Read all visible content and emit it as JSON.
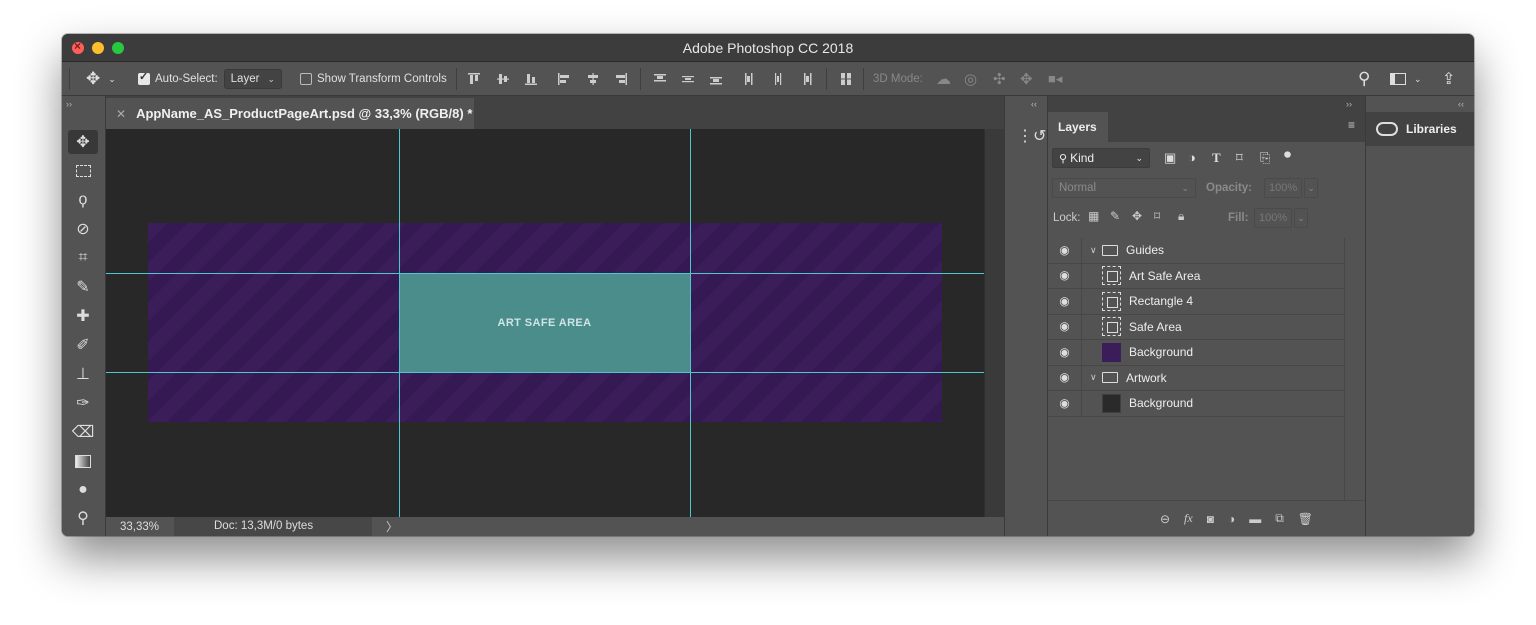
{
  "window": {
    "title": "Adobe Photoshop CC 2018"
  },
  "options_bar": {
    "auto_select_label": "Auto-Select:",
    "auto_select_target": "Layer",
    "show_transform_label": "Show Transform Controls",
    "mode_3d_label": "3D Mode:"
  },
  "document": {
    "tab_title": "AppName_AS_ProductPageArt.psd @ 33,3% (RGB/8) *",
    "canvas_label": "ART SAFE AREA",
    "art_color": "#3b1d5a",
    "safe_area_color": "#4b8d8b",
    "guide_color": "#4fc7d1"
  },
  "status": {
    "zoom": "33,33%",
    "doc_info": "Doc: 13,3M/0 bytes",
    "arrow": "〉"
  },
  "layers_panel": {
    "tab": "Layers",
    "filter_kind": "Kind",
    "blend_mode": "Normal",
    "opacity_label": "Opacity:",
    "opacity_value": "100%",
    "lock_label": "Lock:",
    "fill_label": "Fill:",
    "fill_value": "100%",
    "layers": [
      {
        "name": "Guides",
        "kind": "group",
        "expanded": true
      },
      {
        "name": "Art Safe Area",
        "kind": "shape"
      },
      {
        "name": "Rectangle 4",
        "kind": "shape"
      },
      {
        "name": "Safe Area",
        "kind": "shape"
      },
      {
        "name": "Background",
        "kind": "fill",
        "color": "#3b1d5a"
      },
      {
        "name": "Artwork",
        "kind": "group",
        "expanded": true
      },
      {
        "name": "Background",
        "kind": "fill",
        "color": "#2a2a2a"
      }
    ]
  },
  "libraries_panel": {
    "tab": "Libraries"
  }
}
